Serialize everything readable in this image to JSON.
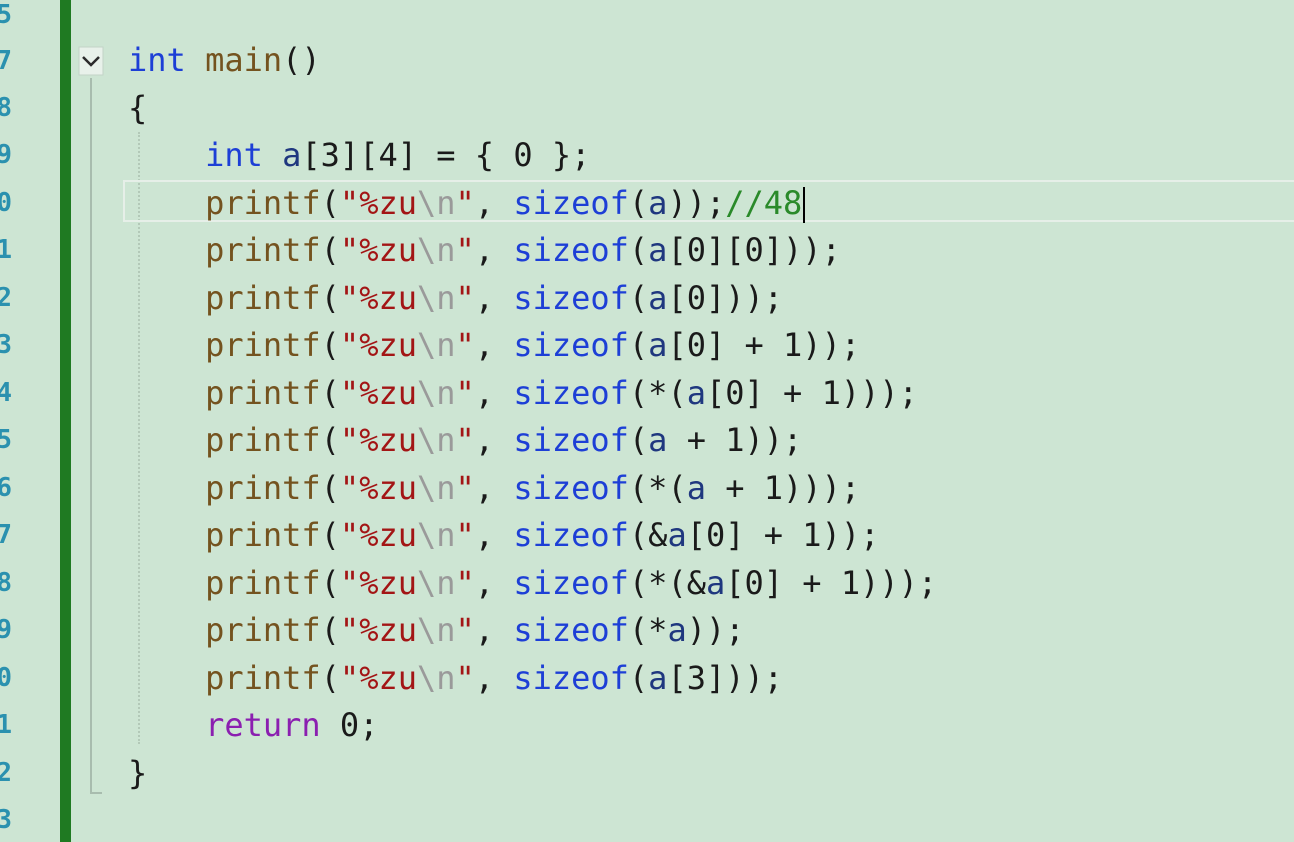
{
  "gutter": {
    "line_numbers": [
      "5",
      "7",
      "8",
      "9",
      "0",
      "1",
      "2",
      "3",
      "4",
      "5",
      "6",
      "7",
      "8",
      "9",
      "0",
      "1",
      "2",
      "3"
    ]
  },
  "code": {
    "lines": [
      [
        {
          "t": "int",
          "c": "kw"
        },
        {
          "t": " "
        },
        {
          "t": "main",
          "c": "fn"
        },
        {
          "t": "()"
        }
      ],
      [
        {
          "t": "{"
        }
      ],
      [
        {
          "t": "    "
        },
        {
          "t": "int",
          "c": "kw"
        },
        {
          "t": " "
        },
        {
          "t": "a",
          "c": "var"
        },
        {
          "t": "[3][4] = { 0 };"
        }
      ],
      [
        {
          "t": "    "
        },
        {
          "t": "printf",
          "c": "fn"
        },
        {
          "t": "("
        },
        {
          "t": "\"%zu",
          "c": "str"
        },
        {
          "t": "\\n",
          "c": "esc"
        },
        {
          "t": "\"",
          "c": "str"
        },
        {
          "t": ", "
        },
        {
          "t": "sizeof",
          "c": "kw"
        },
        {
          "t": "("
        },
        {
          "t": "a",
          "c": "var"
        },
        {
          "t": "));"
        },
        {
          "t": "//48",
          "c": "cmt"
        }
      ],
      [
        {
          "t": "    "
        },
        {
          "t": "printf",
          "c": "fn"
        },
        {
          "t": "("
        },
        {
          "t": "\"%zu",
          "c": "str"
        },
        {
          "t": "\\n",
          "c": "esc"
        },
        {
          "t": "\"",
          "c": "str"
        },
        {
          "t": ", "
        },
        {
          "t": "sizeof",
          "c": "kw"
        },
        {
          "t": "("
        },
        {
          "t": "a",
          "c": "var"
        },
        {
          "t": "[0][0]));"
        }
      ],
      [
        {
          "t": "    "
        },
        {
          "t": "printf",
          "c": "fn"
        },
        {
          "t": "("
        },
        {
          "t": "\"%zu",
          "c": "str"
        },
        {
          "t": "\\n",
          "c": "esc"
        },
        {
          "t": "\"",
          "c": "str"
        },
        {
          "t": ", "
        },
        {
          "t": "sizeof",
          "c": "kw"
        },
        {
          "t": "("
        },
        {
          "t": "a",
          "c": "var"
        },
        {
          "t": "[0]));"
        }
      ],
      [
        {
          "t": "    "
        },
        {
          "t": "printf",
          "c": "fn"
        },
        {
          "t": "("
        },
        {
          "t": "\"%zu",
          "c": "str"
        },
        {
          "t": "\\n",
          "c": "esc"
        },
        {
          "t": "\"",
          "c": "str"
        },
        {
          "t": ", "
        },
        {
          "t": "sizeof",
          "c": "kw"
        },
        {
          "t": "("
        },
        {
          "t": "a",
          "c": "var"
        },
        {
          "t": "[0] + 1));"
        }
      ],
      [
        {
          "t": "    "
        },
        {
          "t": "printf",
          "c": "fn"
        },
        {
          "t": "("
        },
        {
          "t": "\"%zu",
          "c": "str"
        },
        {
          "t": "\\n",
          "c": "esc"
        },
        {
          "t": "\"",
          "c": "str"
        },
        {
          "t": ", "
        },
        {
          "t": "sizeof",
          "c": "kw"
        },
        {
          "t": "(*("
        },
        {
          "t": "a",
          "c": "var"
        },
        {
          "t": "[0] + 1)));"
        }
      ],
      [
        {
          "t": "    "
        },
        {
          "t": "printf",
          "c": "fn"
        },
        {
          "t": "("
        },
        {
          "t": "\"%zu",
          "c": "str"
        },
        {
          "t": "\\n",
          "c": "esc"
        },
        {
          "t": "\"",
          "c": "str"
        },
        {
          "t": ", "
        },
        {
          "t": "sizeof",
          "c": "kw"
        },
        {
          "t": "("
        },
        {
          "t": "a",
          "c": "var"
        },
        {
          "t": " + 1));"
        }
      ],
      [
        {
          "t": "    "
        },
        {
          "t": "printf",
          "c": "fn"
        },
        {
          "t": "("
        },
        {
          "t": "\"%zu",
          "c": "str"
        },
        {
          "t": "\\n",
          "c": "esc"
        },
        {
          "t": "\"",
          "c": "str"
        },
        {
          "t": ", "
        },
        {
          "t": "sizeof",
          "c": "kw"
        },
        {
          "t": "(*("
        },
        {
          "t": "a",
          "c": "var"
        },
        {
          "t": " + 1)));"
        }
      ],
      [
        {
          "t": "    "
        },
        {
          "t": "printf",
          "c": "fn"
        },
        {
          "t": "("
        },
        {
          "t": "\"%zu",
          "c": "str"
        },
        {
          "t": "\\n",
          "c": "esc"
        },
        {
          "t": "\"",
          "c": "str"
        },
        {
          "t": ", "
        },
        {
          "t": "sizeof",
          "c": "kw"
        },
        {
          "t": "(&"
        },
        {
          "t": "a",
          "c": "var"
        },
        {
          "t": "[0] + 1));"
        }
      ],
      [
        {
          "t": "    "
        },
        {
          "t": "printf",
          "c": "fn"
        },
        {
          "t": "("
        },
        {
          "t": "\"%zu",
          "c": "str"
        },
        {
          "t": "\\n",
          "c": "esc"
        },
        {
          "t": "\"",
          "c": "str"
        },
        {
          "t": ", "
        },
        {
          "t": "sizeof",
          "c": "kw"
        },
        {
          "t": "(*(&"
        },
        {
          "t": "a",
          "c": "var"
        },
        {
          "t": "[0] + 1)));"
        }
      ],
      [
        {
          "t": "    "
        },
        {
          "t": "printf",
          "c": "fn"
        },
        {
          "t": "("
        },
        {
          "t": "\"%zu",
          "c": "str"
        },
        {
          "t": "\\n",
          "c": "esc"
        },
        {
          "t": "\"",
          "c": "str"
        },
        {
          "t": ", "
        },
        {
          "t": "sizeof",
          "c": "kw"
        },
        {
          "t": "(*"
        },
        {
          "t": "a",
          "c": "var"
        },
        {
          "t": "));"
        }
      ],
      [
        {
          "t": "    "
        },
        {
          "t": "printf",
          "c": "fn"
        },
        {
          "t": "("
        },
        {
          "t": "\"%zu",
          "c": "str"
        },
        {
          "t": "\\n",
          "c": "esc"
        },
        {
          "t": "\"",
          "c": "str"
        },
        {
          "t": ", "
        },
        {
          "t": "sizeof",
          "c": "kw"
        },
        {
          "t": "("
        },
        {
          "t": "a",
          "c": "var"
        },
        {
          "t": "[3]));"
        }
      ],
      [
        {
          "t": "    "
        },
        {
          "t": "return",
          "c": "ret"
        },
        {
          "t": " 0;"
        }
      ],
      [
        {
          "t": "}"
        }
      ]
    ]
  },
  "colors": {
    "background": "#cde5d3",
    "keyword": "#1d3fd6",
    "return_keyword": "#8b1fb0",
    "function": "#74531f",
    "string": "#a31515",
    "escape": "#9a9a9a",
    "comment": "#2a8a2a",
    "line_number": "#2b91af",
    "change_bar": "#1f7a22"
  },
  "icons": {
    "fold": "chevron-down-icon"
  }
}
